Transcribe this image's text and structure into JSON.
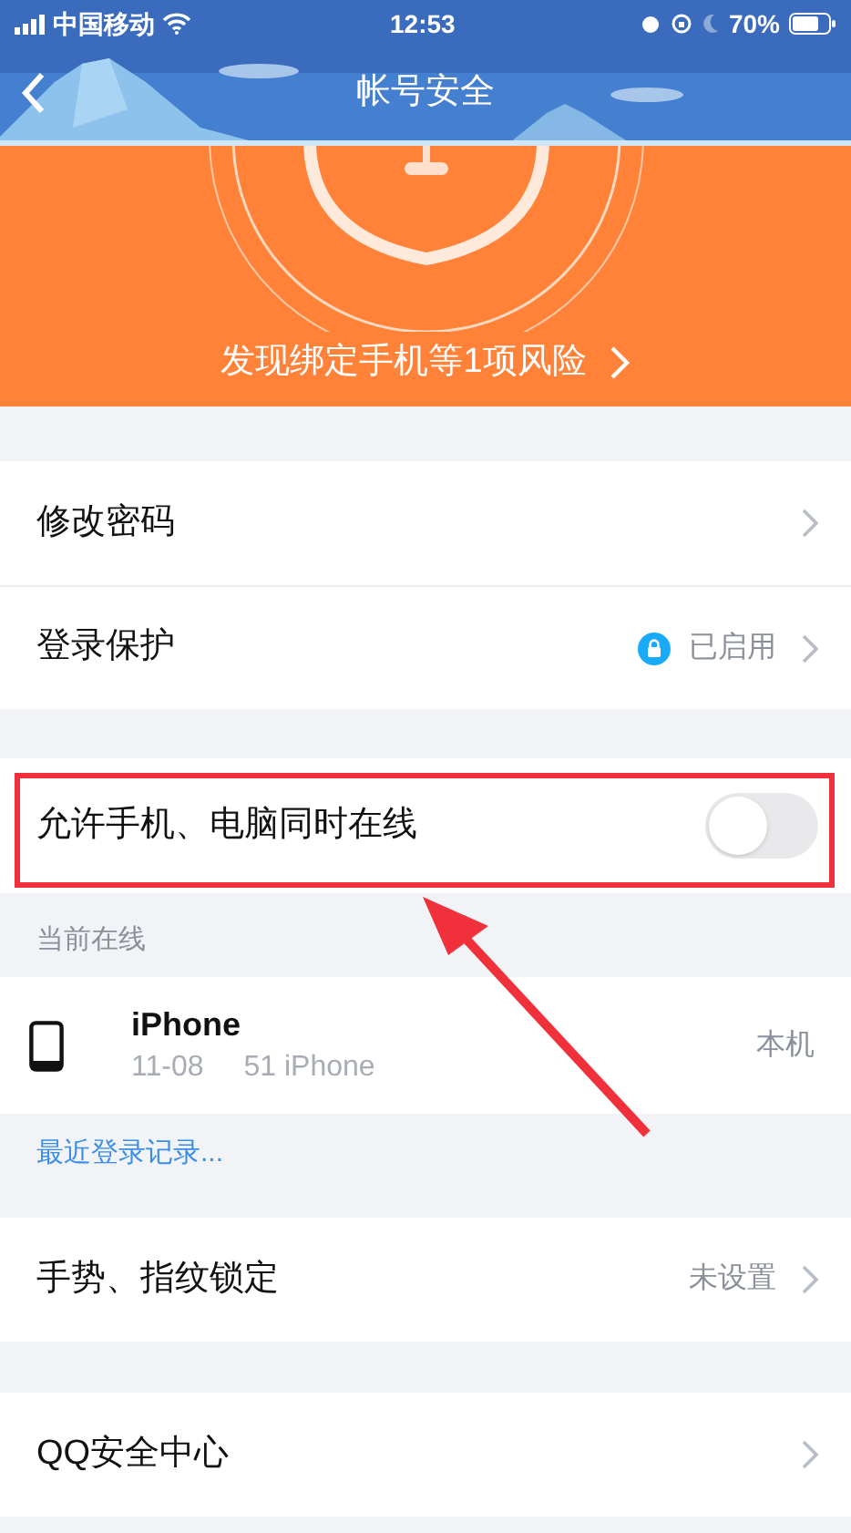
{
  "status_bar": {
    "carrier": "中国移动",
    "time": "12:53",
    "battery": "70%"
  },
  "nav": {
    "title": "帐号安全"
  },
  "banner": {
    "risk_text": "发现绑定手机等1项风险"
  },
  "settings_group_1": [
    {
      "kind": "link",
      "label": "修改密码"
    },
    {
      "kind": "status",
      "label": "登录保护",
      "value": "已启用",
      "locked": true
    }
  ],
  "online_toggle": {
    "label": "允许手机、电脑同时在线",
    "on": false
  },
  "current_online": {
    "header": "当前在线",
    "device": {
      "name": "iPhone",
      "subtitle_parts": [
        "11-08",
        "51 iPhone"
      ],
      "tag": "本机"
    },
    "link": "最近登录记录..."
  },
  "settings_group_2": [
    {
      "kind": "value",
      "label": "手势、指纹锁定",
      "value": "未设置"
    }
  ],
  "settings_group_3": [
    {
      "kind": "link",
      "label": "QQ安全中心"
    }
  ]
}
